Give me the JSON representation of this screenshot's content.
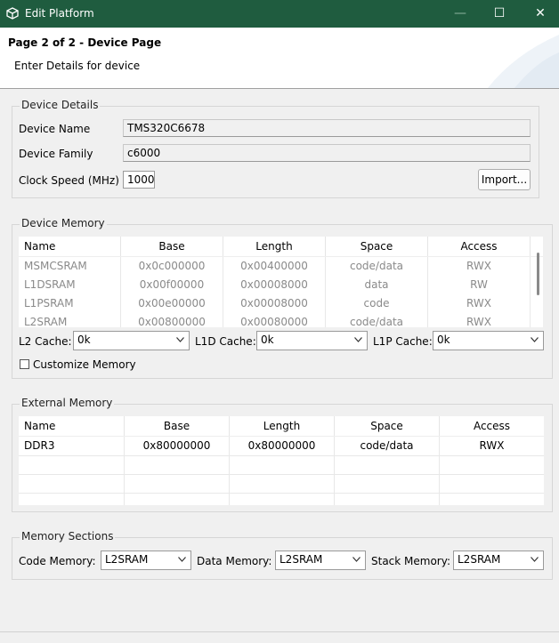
{
  "window": {
    "title": "Edit Platform",
    "minimize": "—",
    "maximize": "☐",
    "close": "✕"
  },
  "header": {
    "page_title": "Page 2 of 2 - Device Page",
    "subtitle": "Enter Details for device"
  },
  "device_details": {
    "group_label": "Device Details",
    "device_name_label": "Device Name",
    "device_name_value": "TMS320C6678",
    "device_family_label": "Device Family",
    "device_family_value": "c6000",
    "clock_speed_label": "Clock Speed (MHz)",
    "clock_speed_value": "1000",
    "import_button": "Import..."
  },
  "device_memory": {
    "group_label": "Device Memory",
    "columns": [
      "Name",
      "Base",
      "Length",
      "Space",
      "Access"
    ],
    "rows": [
      [
        "MSMCSRAM",
        "0x0c000000",
        "0x00400000",
        "code/data",
        "RWX"
      ],
      [
        "L1DSRAM",
        "0x00f00000",
        "0x00008000",
        "data",
        "RW"
      ],
      [
        "L1PSRAM",
        "0x00e00000",
        "0x00008000",
        "code",
        "RWX"
      ],
      [
        "L2SRAM",
        "0x00800000",
        "0x00080000",
        "code/data",
        "RWX"
      ]
    ],
    "l2_cache_label": "L2 Cache:",
    "l2_cache_value": "0k",
    "l1d_cache_label": "L1D Cache:",
    "l1d_cache_value": "0k",
    "l1p_cache_label": "L1P Cache:",
    "l1p_cache_value": "0k",
    "customize_label": "Customize Memory"
  },
  "external_memory": {
    "group_label": "External Memory",
    "columns": [
      "Name",
      "Base",
      "Length",
      "Space",
      "Access"
    ],
    "rows": [
      [
        "DDR3",
        "0x80000000",
        "0x80000000",
        "code/data",
        "RWX"
      ]
    ]
  },
  "memory_sections": {
    "group_label": "Memory Sections",
    "code_label": "Code Memory:",
    "code_value": "L2SRAM",
    "data_label": "Data Memory:",
    "data_value": "L2SRAM",
    "stack_label": "Stack Memory:",
    "stack_value": "L2SRAM"
  },
  "colors": {
    "titlebar": "#1f5c3f",
    "dim_text": "#8a8a8a"
  }
}
